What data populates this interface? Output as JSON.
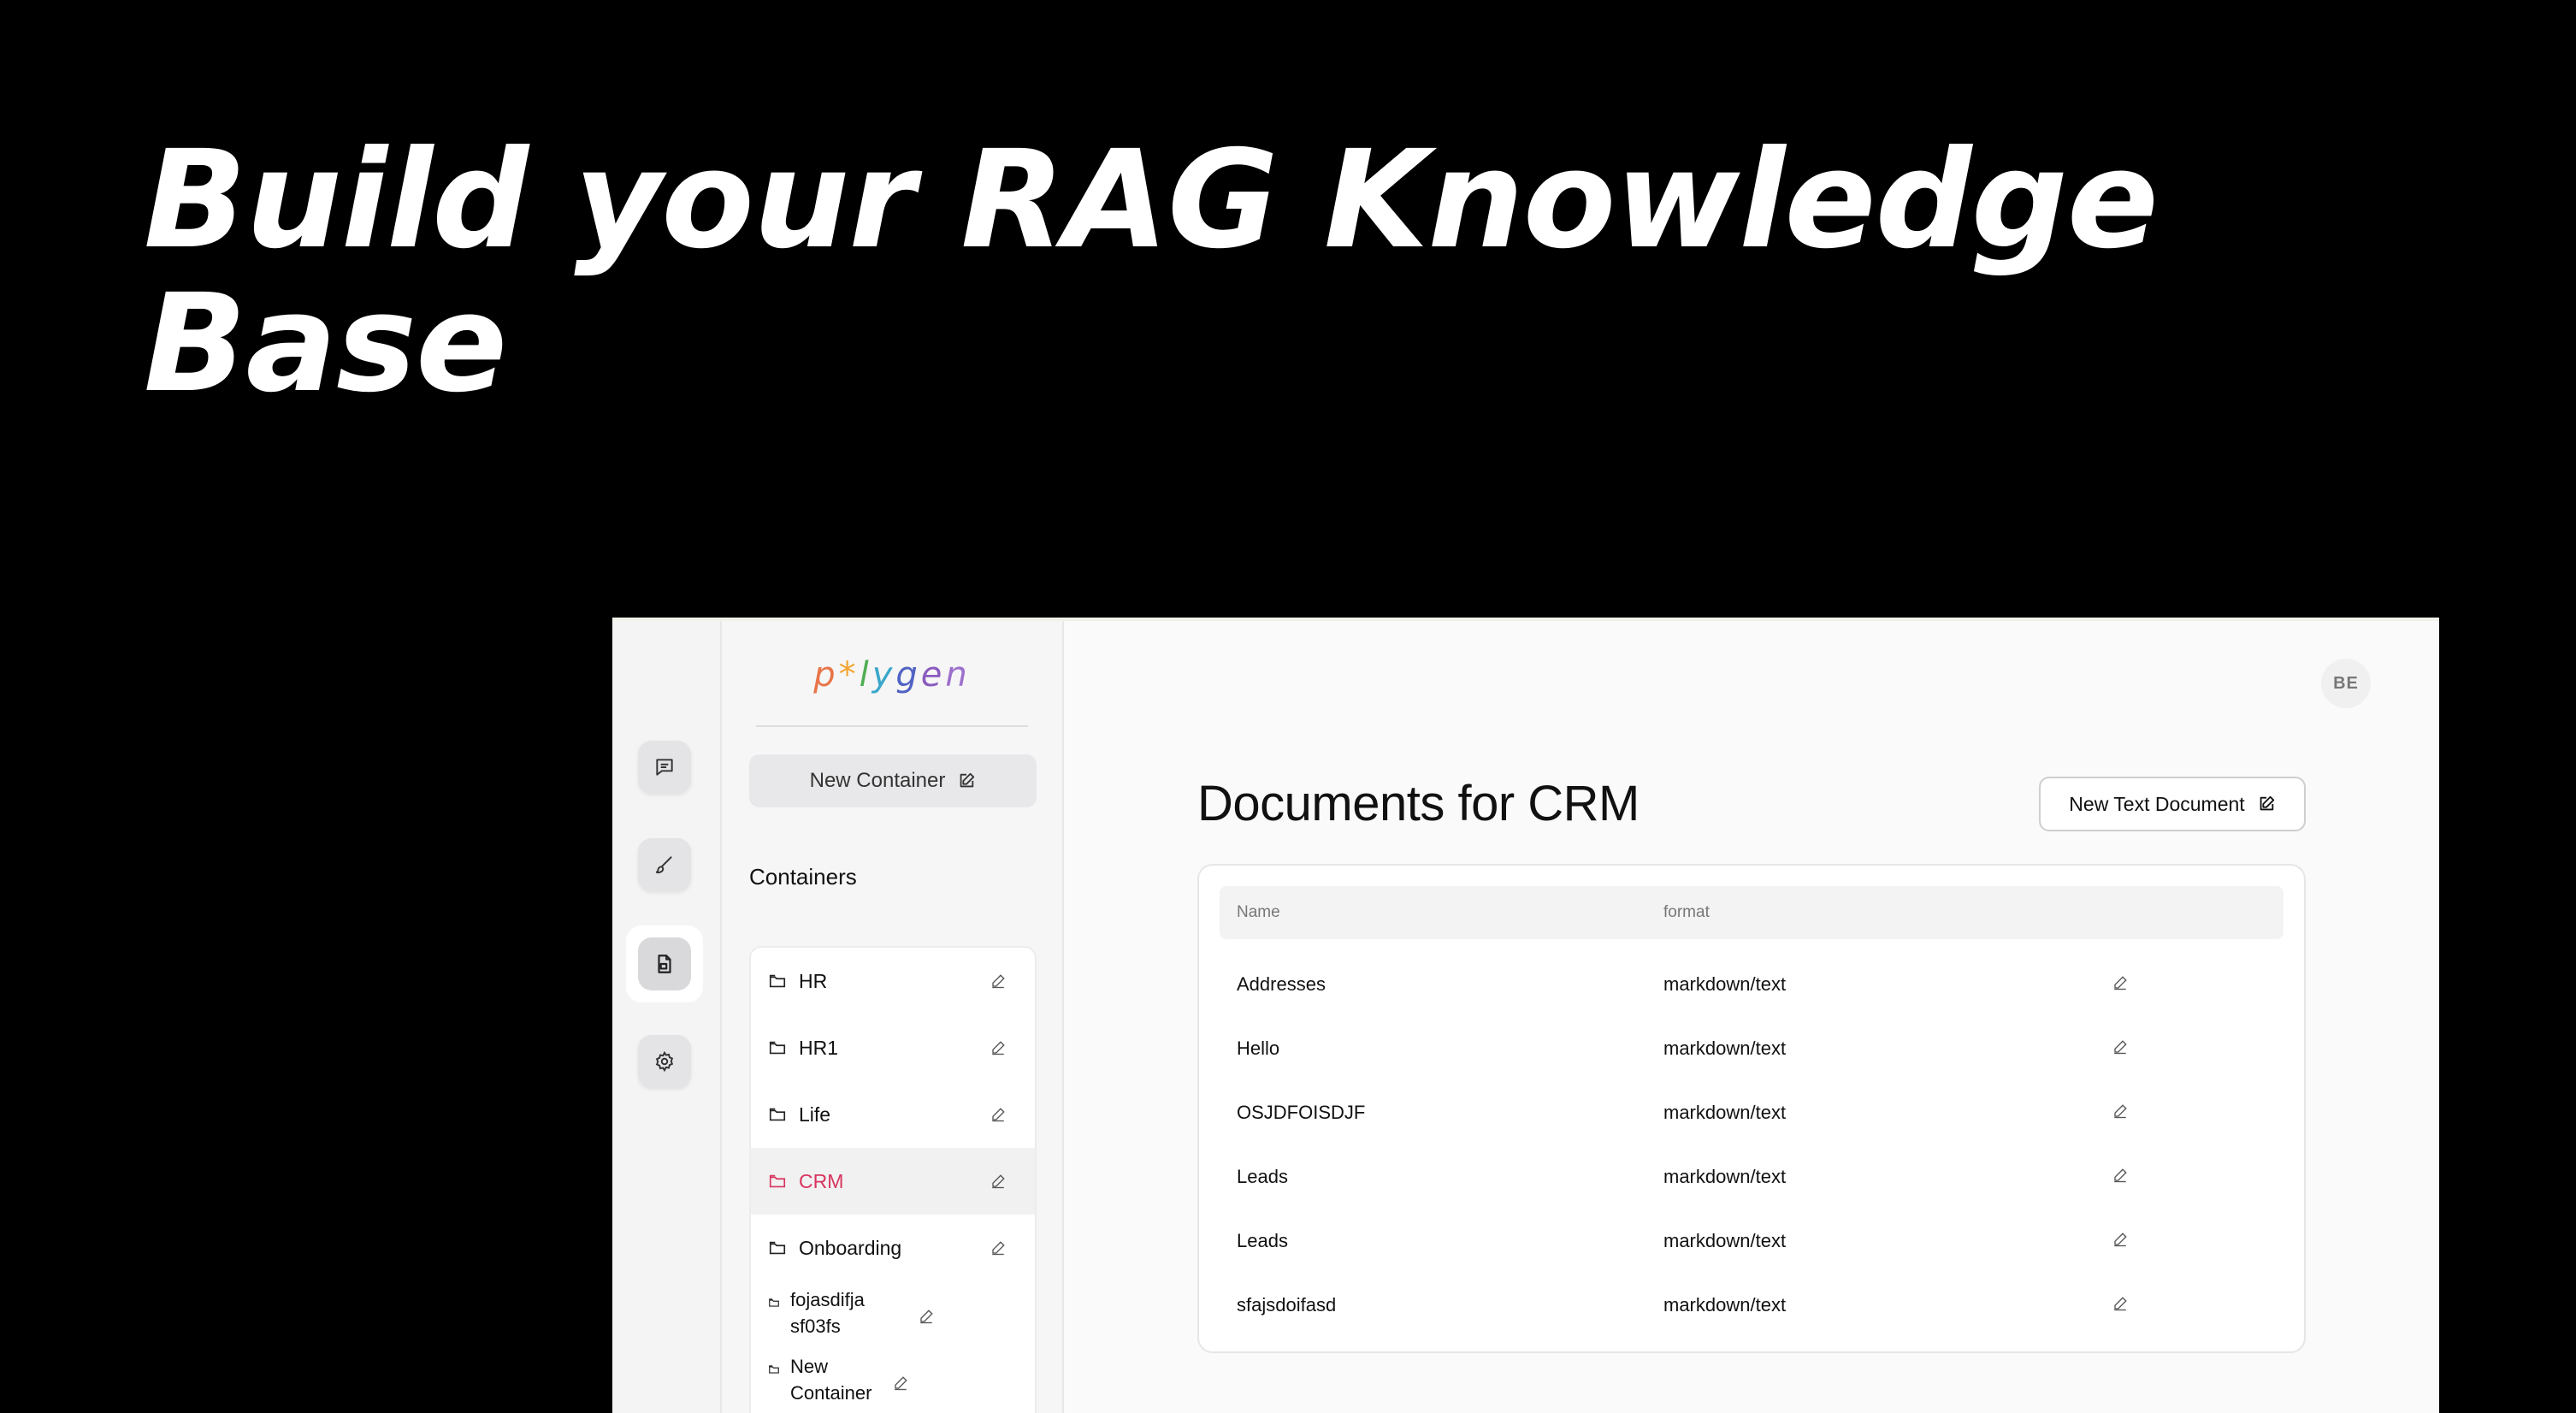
{
  "hero": {
    "line1": "Build your RAG Knowledge",
    "line2": "Base"
  },
  "rail": {
    "items": [
      {
        "icon": "chat-icon"
      },
      {
        "icon": "brush-icon"
      },
      {
        "icon": "document-icon",
        "active": true
      },
      {
        "icon": "gear-icon"
      }
    ]
  },
  "sidebar": {
    "logo": [
      "p",
      "*",
      "l",
      "y",
      "g",
      "e",
      "n"
    ],
    "new_container_label": "New Container",
    "containers_title": "Containers",
    "items": [
      {
        "label": "HR"
      },
      {
        "label": "HR1"
      },
      {
        "label": "Life"
      },
      {
        "label": "CRM",
        "active": true
      },
      {
        "label": "Onboarding"
      },
      {
        "label": "fojasdifja sf03fs"
      },
      {
        "label": "New Container"
      }
    ]
  },
  "main": {
    "avatar": "BE",
    "title": "Documents for CRM",
    "new_doc_label": "New Text Document",
    "table": {
      "headers": [
        "Name",
        "format"
      ],
      "rows": [
        {
          "name": "Addresses",
          "format": "markdown/text"
        },
        {
          "name": "Hello",
          "format": "markdown/text"
        },
        {
          "name": "OSJDFOISDJF",
          "format": "markdown/text"
        },
        {
          "name": "Leads",
          "format": "markdown/text"
        },
        {
          "name": "Leads",
          "format": "markdown/text"
        },
        {
          "name": "sfajsdoifasd",
          "format": "markdown/text"
        }
      ]
    }
  },
  "colors": {
    "active_container": "#d8345f",
    "background": "#000000",
    "app_bg": "#fafafa"
  }
}
